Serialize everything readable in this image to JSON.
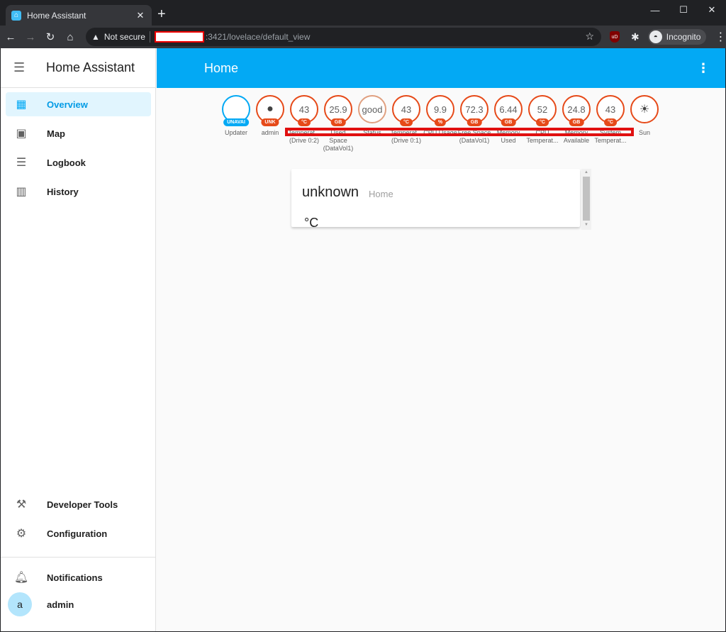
{
  "browser": {
    "tab_title": "Home Assistant",
    "tab_close": "✕",
    "new_tab": "+",
    "not_secure": "Not secure",
    "url": ":3421/lovelace/default_view",
    "incognito_label": "Incognito",
    "ublock_label": "uD"
  },
  "sidebar": {
    "title": "Home Assistant",
    "items": [
      {
        "label": "Overview",
        "icon": "grid-icon"
      },
      {
        "label": "Map",
        "icon": "map-person-icon"
      },
      {
        "label": "Logbook",
        "icon": "list-icon"
      },
      {
        "label": "History",
        "icon": "chart-icon"
      }
    ],
    "bottom_items": [
      {
        "label": "Developer Tools",
        "icon": "hammer-icon"
      },
      {
        "label": "Configuration",
        "icon": "gear-icon"
      }
    ],
    "notifications_label": "Notifications",
    "user_label": "admin",
    "avatar_letter": "a"
  },
  "header": {
    "title": "Home"
  },
  "badges": [
    {
      "value": "",
      "unit": "UNAVAI",
      "label": "Updater",
      "style": "blue"
    },
    {
      "value": "",
      "unit": "UNK",
      "label": "admin",
      "icon": "person-icon"
    },
    {
      "value": "43",
      "unit": "°C",
      "label": "Temperat... (Drive 0:2)"
    },
    {
      "value": "25.9",
      "unit": "GB",
      "label": "Used Space (DataVol1)"
    },
    {
      "value": "good",
      "unit": "",
      "label": "Status"
    },
    {
      "value": "43",
      "unit": "°C",
      "label": "Temperat... (Drive 0:1)"
    },
    {
      "value": "9.9",
      "unit": "%",
      "label": "CPU Usage"
    },
    {
      "value": "72.3",
      "unit": "GB",
      "label": "Free Space (DataVol1)"
    },
    {
      "value": "6.44",
      "unit": "GB",
      "label": "Memory Used"
    },
    {
      "value": "52",
      "unit": "°C",
      "label": "CPU Temperat..."
    },
    {
      "value": "24.8",
      "unit": "GB",
      "label": "Memory Available"
    },
    {
      "value": "43",
      "unit": "°C",
      "label": "System Temperat..."
    },
    {
      "value": "",
      "unit": "",
      "label": "Sun",
      "icon": "sun-icon"
    }
  ],
  "card": {
    "state": "unknown",
    "name": "Home",
    "unit": "°C"
  },
  "colors": {
    "accent": "#03a9f4",
    "badge_border": "#e64a19"
  }
}
